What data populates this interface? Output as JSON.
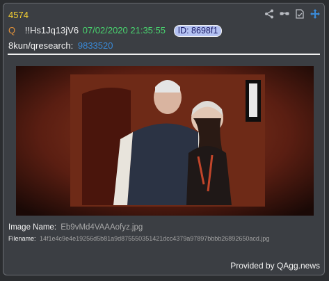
{
  "post": {
    "number": "4574",
    "marker": "Q",
    "tripcode": "!!Hs1Jq13jV6",
    "datetime": "07/02/2020 21:35:55",
    "id_badge": "ID: 8698f1",
    "board": "8kun/qresearch:",
    "thread_number": "9833520"
  },
  "actions": [
    {
      "name": "share-icon"
    },
    {
      "name": "glasses-icon"
    },
    {
      "name": "document-icon"
    },
    {
      "name": "move-icon"
    }
  ],
  "image": {
    "name_label": "Image Name:",
    "name_value": "Eb9vMd4VAAAofyz.jpg",
    "filename_label": "Filename:",
    "filename_value": "14f1e4c9e4e19256d5b81a9d875550351421dcc4379a97897bbbb26892650acd.jpg"
  },
  "footer": {
    "provided": "Provided by QAgg.news"
  },
  "colors": {
    "post_number": "#f5d033",
    "marker": "#e2913a",
    "date": "#49d56f",
    "thread_link": "#3a8ad8",
    "accent_icon": "#3a8ad8"
  }
}
